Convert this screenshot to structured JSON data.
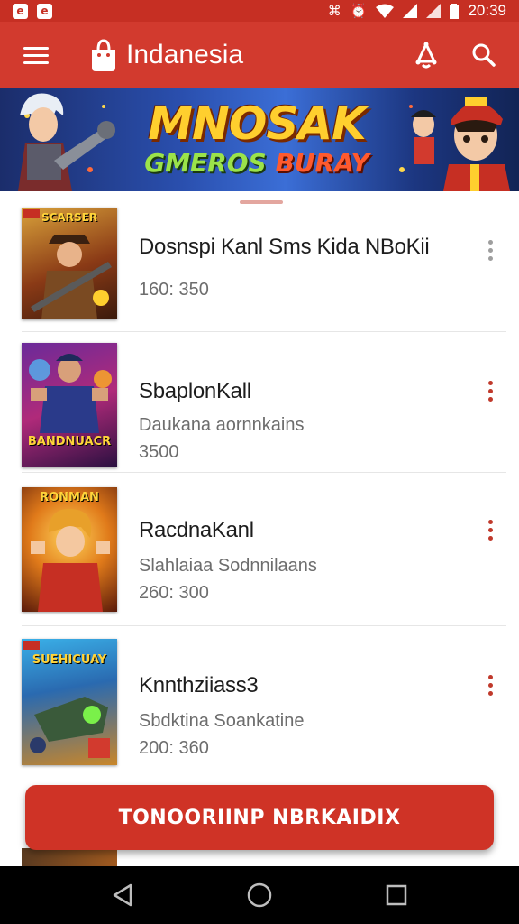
{
  "status_bar": {
    "time": "20:39",
    "left_icons": [
      "e",
      "e"
    ]
  },
  "app_bar": {
    "title": "Indanesia",
    "icons": [
      "menu-icon",
      "bag-logo-icon",
      "notification-bell-icon",
      "search-icon"
    ]
  },
  "banner": {
    "title": "MNOSAK",
    "subtitle_part1": "GMEROS ",
    "subtitle_part2": "BURAY"
  },
  "games": [
    {
      "title": "Dosnspi Kanl Sms Kida NBoKii",
      "subtitle": "",
      "count": "160: 350",
      "cover_text": "SCARSER",
      "more_color": "#9e9e9e"
    },
    {
      "title": "SbaplonKall",
      "subtitle": "Daukana aornnkains",
      "count": "3500",
      "cover_text": "BANDNUACR",
      "more_color": "#c0392b"
    },
    {
      "title": "RacdnaKanl",
      "subtitle": "Slahlaiaa Sodnnilaans",
      "count": "260: 300",
      "cover_text": "RONMAN",
      "more_color": "#c0392b"
    },
    {
      "title": "Knnthziiass3",
      "subtitle": "Sbdktina Soankatine",
      "count": "200: 360",
      "cover_text": "SUEHICUAY",
      "more_color": "#c0392b"
    }
  ],
  "cta": {
    "label": "TONOORIINP NBRKAIDIX"
  },
  "colors": {
    "primary": "#d23a2e",
    "status": "#c62f23"
  }
}
